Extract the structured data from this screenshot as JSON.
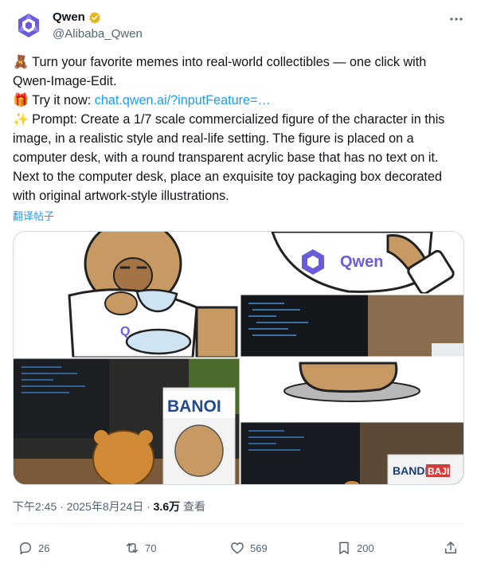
{
  "author": {
    "name": "Qwen",
    "handle": "@Alibaba_Qwen",
    "avatar_icon": "qwen-logo-icon",
    "verified_icon": "verified-badge-icon",
    "verified_color": "#e2b719"
  },
  "post": {
    "line1_emoji": "🧸",
    "line1_text": "Turn your favorite memes into real-world collectibles — one click with Qwen-Image-Edit.",
    "line2_emoji": "🎁",
    "line2_prefix": "Try it now: ",
    "line2_link": "chat.qwen.ai/?inputFeature=…",
    "line3_emoji": "✨",
    "line3_text": "Prompt: Create a 1/7 scale commercialized figure of the character in this image, in a realistic style and real-life setting. The figure is placed on a computer desk, with a round transparent acrylic base that has no text on it. Next to the computer desk, place an exquisite toy packaging box decorated with original artwork-style illustrations."
  },
  "translate_label": "翻译帖子",
  "media": {
    "panel1_brand": "Qwen",
    "box1_brand": "BANOI",
    "box2_brand1": "BANDI",
    "box2_brand2": "BAJI"
  },
  "meta": {
    "time": "下午2:45 · 2025年8月24日 · ",
    "views_count": "3.6万",
    "views_label": " 查看"
  },
  "actions": {
    "replies": "26",
    "reposts": "70",
    "likes": "569",
    "bookmarks": "200"
  },
  "colors": {
    "link": "#1d9bf0",
    "muted": "#536471",
    "qwen_purple": "#6a5cd8"
  }
}
